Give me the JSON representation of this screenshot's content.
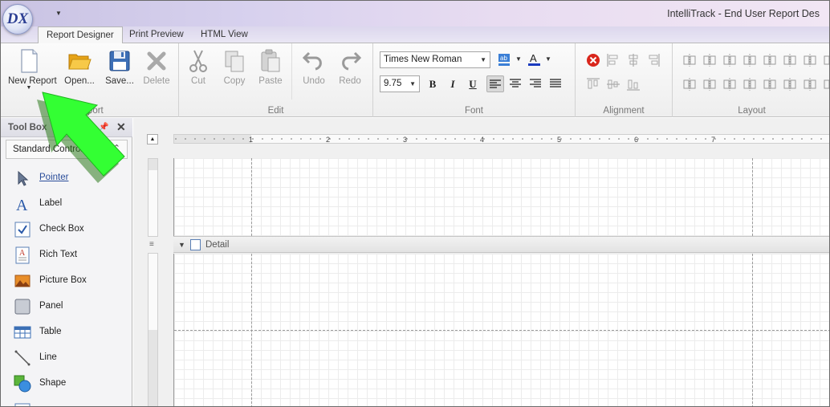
{
  "window": {
    "logo_text": "DX",
    "title": "IntelliTrack - End User Report Des"
  },
  "tabs": [
    "Report Designer",
    "Print Preview",
    "HTML View"
  ],
  "ribbon": {
    "report_group": {
      "title": "Report",
      "new_report": "New Report",
      "open": "Open...",
      "save": "Save...",
      "delete": "Delete"
    },
    "edit_group": {
      "title": "Edit",
      "cut": "Cut",
      "copy": "Copy",
      "paste": "Paste",
      "undo": "Undo",
      "redo": "Redo"
    },
    "font_group": {
      "title": "Font",
      "font_name": "Times New Roman",
      "font_size": "9.75",
      "bold": "B",
      "italic": "I",
      "underline": "U",
      "highlight_icon_text": "ab",
      "font_color_icon_text": "A"
    },
    "alignment_group": {
      "title": "Alignment"
    },
    "layout_group": {
      "title": "Layout"
    }
  },
  "toolbox": {
    "title": "Tool Box",
    "category": "Standard Controls",
    "items": [
      {
        "label": "Pointer",
        "icon": "pointer-icon"
      },
      {
        "label": "Label",
        "icon": "label-icon"
      },
      {
        "label": "Check Box",
        "icon": "checkbox-icon"
      },
      {
        "label": "Rich Text",
        "icon": "rich-text-icon"
      },
      {
        "label": "Picture Box",
        "icon": "picture-box-icon"
      },
      {
        "label": "Panel",
        "icon": "panel-icon"
      },
      {
        "label": "Table",
        "icon": "table-icon"
      },
      {
        "label": "Line",
        "icon": "line-icon"
      },
      {
        "label": "Shape",
        "icon": "shape-icon"
      }
    ]
  },
  "ruler": {
    "numbers": [
      "1",
      "2",
      "3",
      "4",
      "5",
      "6",
      "7"
    ]
  },
  "designer": {
    "detail_band_label": "Detail"
  },
  "colors": {
    "annotation_arrow": "#33ff33",
    "accent": "#2a4d9a"
  }
}
